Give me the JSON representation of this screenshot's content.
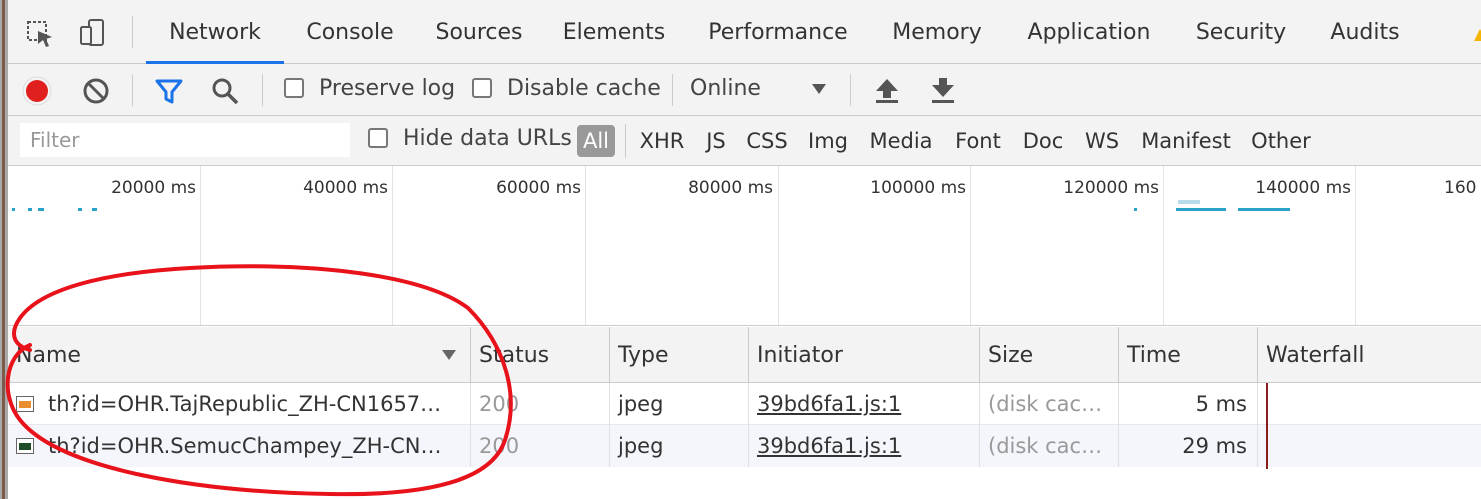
{
  "tabs": [
    {
      "label": "Network",
      "active": true
    },
    {
      "label": "Console"
    },
    {
      "label": "Sources"
    },
    {
      "label": "Elements"
    },
    {
      "label": "Performance"
    },
    {
      "label": "Memory"
    },
    {
      "label": "Application"
    },
    {
      "label": "Security"
    },
    {
      "label": "Audits"
    }
  ],
  "toolbar": {
    "preserve_log": "Preserve log",
    "disable_cache": "Disable cache",
    "throttle": "Online"
  },
  "filter": {
    "placeholder": "Filter",
    "hide_data_urls": "Hide data URLs",
    "types": [
      "All",
      "XHR",
      "JS",
      "CSS",
      "Img",
      "Media",
      "Font",
      "Doc",
      "WS",
      "Manifest",
      "Other"
    ]
  },
  "overview": {
    "ticks": [
      "20000 ms",
      "40000 ms",
      "60000 ms",
      "80000 ms",
      "100000 ms",
      "120000 ms",
      "140000 ms",
      "160"
    ]
  },
  "table": {
    "columns": [
      "Name",
      "Status",
      "Type",
      "Initiator",
      "Size",
      "Time",
      "Waterfall"
    ],
    "rows": [
      {
        "name": "th?id=OHR.TajRepublic_ZH-CN1657…",
        "status": "200",
        "type": "jpeg",
        "initiator": "39bd6fa1.js:1",
        "size": "(disk cac…",
        "time": "5 ms",
        "thumb": "orange"
      },
      {
        "name": "th?id=OHR.SemucChampey_ZH-CN…",
        "status": "200",
        "type": "jpeg",
        "initiator": "39bd6fa1.js:1",
        "size": "(disk cac…",
        "time": "29 ms",
        "thumb": "green"
      }
    ]
  },
  "colors": {
    "accent": "#1a73e8",
    "record": "#e0201f",
    "filter_icon": "#1a73e8",
    "annotation": "#e8121b",
    "overview_marks": "#29a3c9"
  }
}
